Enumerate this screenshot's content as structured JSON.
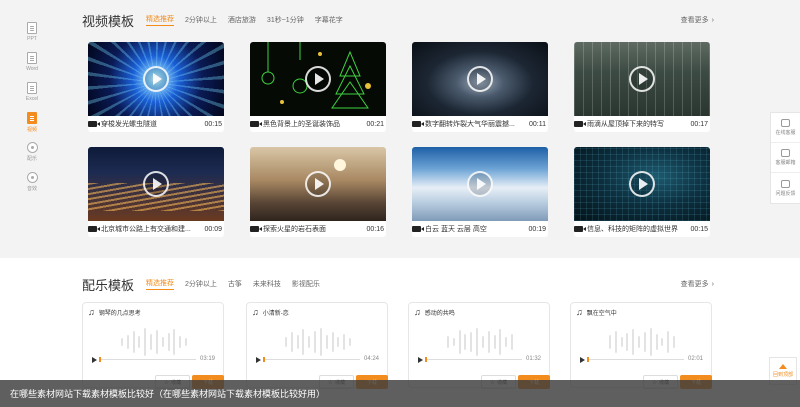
{
  "left_sidebar": [
    {
      "label": "PPT",
      "icon": "ppt-file-icon",
      "active": false
    },
    {
      "label": "Word",
      "icon": "word-file-icon",
      "active": false
    },
    {
      "label": "Excel",
      "icon": "excel-file-icon",
      "active": false
    },
    {
      "label": "视频",
      "icon": "video-icon",
      "active": true
    },
    {
      "label": "配乐",
      "icon": "music-icon",
      "active": false
    },
    {
      "label": "音效",
      "icon": "headphone-icon",
      "active": false
    }
  ],
  "right_sidebar": [
    {
      "label": "在线客服",
      "icon": "chat-icon"
    },
    {
      "label": "客服邮箱",
      "icon": "mail-icon"
    },
    {
      "label": "问题反馈",
      "icon": "feedback-icon"
    }
  ],
  "back_to_top": {
    "label": "回到顶部"
  },
  "video_section": {
    "title": "视频模板",
    "tabs": [
      "精选推荐",
      "2分钟以上",
      "酒店旅游",
      "31秒~1分钟",
      "字幕花字"
    ],
    "active_tab": 0,
    "more": "查看更多",
    "items": [
      {
        "title": "穿梭发光螺虫隧道",
        "duration": "00:15"
      },
      {
        "title": "黑色背景上的圣诞装饰品",
        "duration": "00:21"
      },
      {
        "title": "数字翻转炸裂大气华丽震撼...",
        "duration": "00:11"
      },
      {
        "title": "雨滴从屋顶掉下来的特写",
        "duration": "00:17"
      },
      {
        "title": "北京城市公路上有交通和建...",
        "duration": "00:09"
      },
      {
        "title": "探索火星的岩石表面",
        "duration": "00:16"
      },
      {
        "title": "白云 蓝天 云层 高空",
        "duration": "00:19"
      },
      {
        "title": "信息、科技的矩阵的虚拟世界",
        "duration": "00:15"
      }
    ]
  },
  "music_section": {
    "title": "配乐模板",
    "tabs": [
      "精选推荐",
      "2分钟以上",
      "古筝",
      "未来科技",
      "影视配乐"
    ],
    "active_tab": 0,
    "more": "查看更多",
    "items": [
      {
        "title": "钢琴的几点思考",
        "duration": "03:19",
        "fav": "收藏",
        "download": "下载"
      },
      {
        "title": "小清新-恋",
        "duration": "04:24",
        "fav": "收藏",
        "download": "下载"
      },
      {
        "title": "感动的共鸣",
        "duration": "01:32",
        "fav": "收藏",
        "download": "下载"
      },
      {
        "title": "飘在空气中",
        "duration": "02:01",
        "fav": "收藏",
        "download": "下载"
      }
    ]
  },
  "caption": "在哪些素材网站下载素材模板比较好（在哪些素材网站下载素材模板比较好用）",
  "colors": {
    "accent": "#f28c1e",
    "background": "#f3f3f3",
    "caption_bg": "#3c3c3c"
  }
}
